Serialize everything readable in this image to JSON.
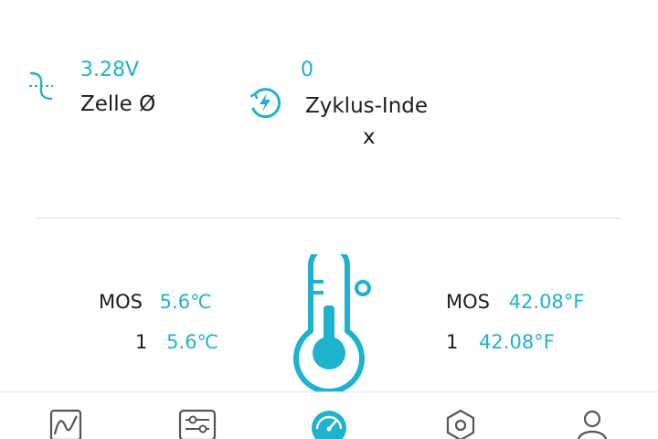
{
  "stats": {
    "cell_avg": {
      "value": "3.28V",
      "label": "Zelle Ø",
      "icon": "wave-icon"
    },
    "cycle_index": {
      "value": "0",
      "label_line1": "Zyklus-Inde",
      "label_line2": "x",
      "icon": "lightning-circle-icon"
    }
  },
  "temperature": {
    "icon": "thermometer-icon",
    "left": [
      {
        "key": "MOS",
        "value": "5.6℃"
      },
      {
        "key": "1",
        "value": "5.6℃"
      }
    ],
    "right": [
      {
        "key": "MOS",
        "value": "42.08°F"
      },
      {
        "key": "1",
        "value": "42.08°F"
      }
    ]
  },
  "tabbar": {
    "active_index": 2,
    "tabs": [
      {
        "icon": "chart-curve-icon"
      },
      {
        "icon": "sliders-icon"
      },
      {
        "icon": "gauge-icon"
      },
      {
        "icon": "hexagon-settings-icon"
      },
      {
        "icon": "user-icon"
      }
    ]
  },
  "colors": {
    "accent": "#1fb2cf",
    "text": "#1c1c1c",
    "inactive_icon": "#555555",
    "divider": "#dcdcdc"
  }
}
